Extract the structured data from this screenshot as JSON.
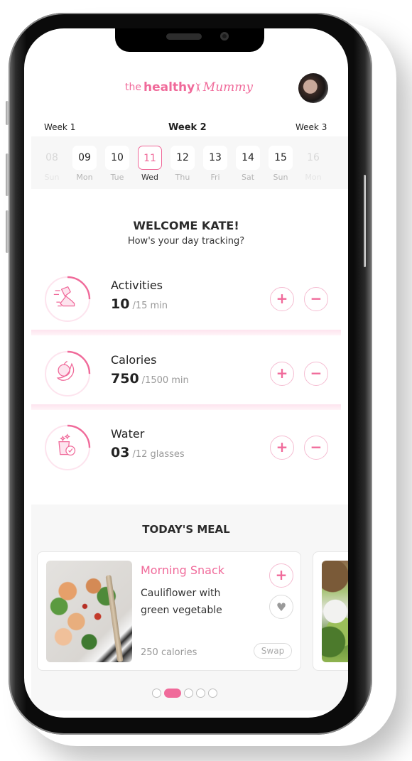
{
  "app": {
    "brand": {
      "prefix": "the",
      "main": "healthy",
      "suffix": "Mummy"
    },
    "accent_color": "#f06a9a"
  },
  "header": {
    "avatar": "user-avatar"
  },
  "calendar": {
    "weeks": [
      {
        "label": "Week 1",
        "active": false
      },
      {
        "label": "Week 2",
        "active": true
      },
      {
        "label": "Week 3",
        "active": false
      }
    ],
    "days": [
      {
        "num": "08",
        "name": "Sun",
        "state": "faded"
      },
      {
        "num": "09",
        "name": "Mon",
        "state": "normal"
      },
      {
        "num": "10",
        "name": "Tue",
        "state": "normal"
      },
      {
        "num": "11",
        "name": "Wed",
        "state": "selected"
      },
      {
        "num": "12",
        "name": "Thu",
        "state": "normal"
      },
      {
        "num": "13",
        "name": "Fri",
        "state": "normal"
      },
      {
        "num": "14",
        "name": "Sat",
        "state": "normal"
      },
      {
        "num": "15",
        "name": "Sun",
        "state": "normal"
      },
      {
        "num": "16",
        "name": "Mon",
        "state": "faded"
      }
    ]
  },
  "welcome": {
    "title": "WELCOME KATE!",
    "subtitle": "How's your day tracking?"
  },
  "trackers": [
    {
      "label": "Activities",
      "value": "10",
      "goal": "/15 min",
      "progress": 0.25,
      "icon": "sneaker-icon"
    },
    {
      "label": "Calories",
      "value": "750",
      "goal": "/1500 min",
      "progress": 0.25,
      "icon": "apple-banana-icon"
    },
    {
      "label": "Water",
      "value": "03",
      "goal": "/12 glasses",
      "progress": 0.25,
      "icon": "water-glass-icon"
    }
  ],
  "tracker_buttons": {
    "plus": "+",
    "minus": "−"
  },
  "meals": {
    "title": "TODAY'S MEAL",
    "cards": [
      {
        "type": "Morning Snack",
        "name": "Cauliflower with green vegetable",
        "calories": "250 calories",
        "swap_label": "Swap",
        "add_label": "+",
        "fav_icon": "♥"
      }
    ],
    "pager": {
      "count": 5,
      "active_index": 1
    }
  }
}
